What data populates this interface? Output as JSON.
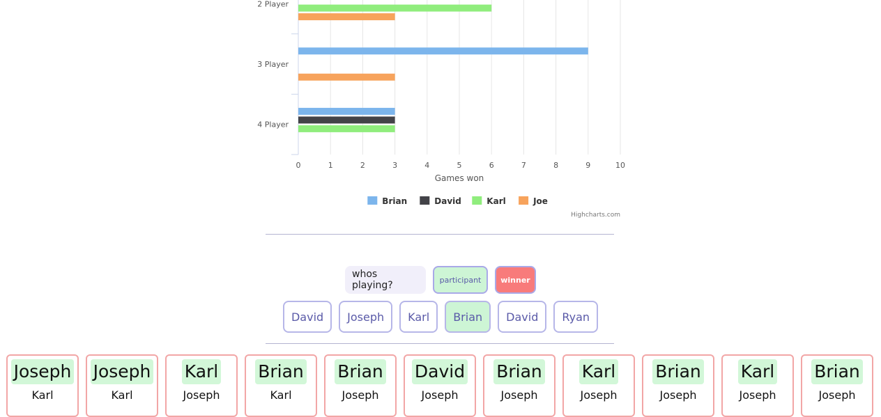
{
  "chart_data": {
    "type": "bar",
    "orientation": "horizontal",
    "categories": [
      "2 Player",
      "3 Player",
      "4 Player"
    ],
    "series": [
      {
        "name": "Brian",
        "color": "#7cb5ec",
        "values": [
          null,
          9,
          3
        ]
      },
      {
        "name": "David",
        "color": "#434348",
        "values": [
          null,
          null,
          3
        ]
      },
      {
        "name": "Karl",
        "color": "#90ed7d",
        "values": [
          6,
          null,
          3
        ]
      },
      {
        "name": "Joe",
        "color": "#f7a35c",
        "values": [
          3,
          3,
          null
        ]
      }
    ],
    "xlabel": "Games won",
    "xlim": [
      0,
      10
    ],
    "ticks": [
      "0",
      "1",
      "2",
      "3",
      "4",
      "5",
      "6",
      "7",
      "8",
      "9",
      "10"
    ],
    "grid": true,
    "legend_position": "bottom-center",
    "credit": "Highcharts.com"
  },
  "controls": {
    "question": "whos playing?",
    "participant_label": "participant",
    "winner_label": "winner"
  },
  "players": [
    {
      "name": "David",
      "selected": false
    },
    {
      "name": "Joseph",
      "selected": false
    },
    {
      "name": "Karl",
      "selected": false
    },
    {
      "name": "Brian",
      "selected": true
    },
    {
      "name": "David",
      "selected": false
    },
    {
      "name": "Ryan",
      "selected": false
    }
  ],
  "games": [
    {
      "winner": "Joseph",
      "participant": "Karl"
    },
    {
      "winner": "Joseph",
      "participant": "Karl"
    },
    {
      "winner": "Karl",
      "participant": "Joseph"
    },
    {
      "winner": "Brian",
      "participant": "Karl"
    },
    {
      "winner": "Brian",
      "participant": "Joseph"
    },
    {
      "winner": "David",
      "participant": "Joseph"
    },
    {
      "winner": "Brian",
      "participant": "Joseph"
    },
    {
      "winner": "Karl",
      "participant": "Joseph"
    },
    {
      "winner": "Brian",
      "participant": "Joseph"
    },
    {
      "winner": "Karl",
      "participant": "Joseph"
    },
    {
      "winner": "Brian",
      "participant": "Joseph"
    }
  ]
}
